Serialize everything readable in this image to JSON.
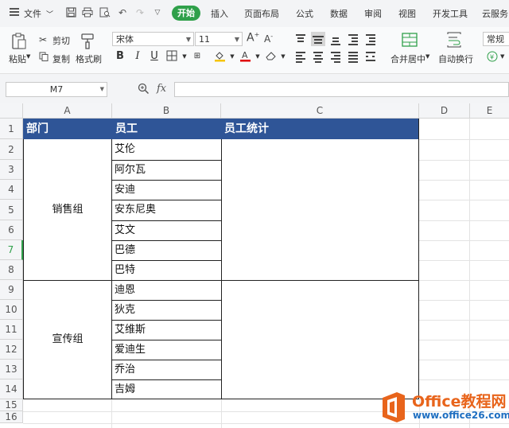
{
  "menu": {
    "file": "文件",
    "tabs": [
      "开始",
      "插入",
      "页面布局",
      "公式",
      "数据",
      "审阅",
      "视图",
      "开发工具",
      "云服务"
    ]
  },
  "ribbon": {
    "paste": "粘贴",
    "cut": "剪切",
    "copy": "复制",
    "format_painter": "格式刷",
    "font_name": "宋体",
    "font_size": "11",
    "merge_center": "合并居中",
    "wrap_text": "自动换行",
    "number_format": "常规"
  },
  "formula_bar": {
    "cell_ref": "M7",
    "fx": "fx",
    "formula": ""
  },
  "sheet": {
    "columns": [
      "A",
      "B",
      "C",
      "D",
      "E"
    ],
    "rows": [
      "1",
      "2",
      "3",
      "4",
      "5",
      "6",
      "7",
      "8",
      "9",
      "10",
      "11",
      "12",
      "13",
      "14",
      "15",
      "16"
    ],
    "header": {
      "a": "部门",
      "b": "员工",
      "c": "员工统计"
    },
    "groups": [
      {
        "dept": "销售组",
        "members": [
          "艾伦",
          "阿尔瓦",
          "安迪",
          "安东尼奥",
          "艾文",
          "巴德",
          "巴特"
        ]
      },
      {
        "dept": "宣传组",
        "members": [
          "迪恩",
          "狄克",
          "艾维斯",
          "爱迪生",
          "乔治",
          "吉姆"
        ]
      }
    ]
  },
  "watermark": {
    "brand": "Office教程网",
    "url": "www.office26.com"
  },
  "colors": {
    "accent_green": "#2fa04a",
    "header_blue": "#2f5597",
    "watermark_orange": "#e8641b",
    "watermark_blue": "#1f6fc1"
  }
}
